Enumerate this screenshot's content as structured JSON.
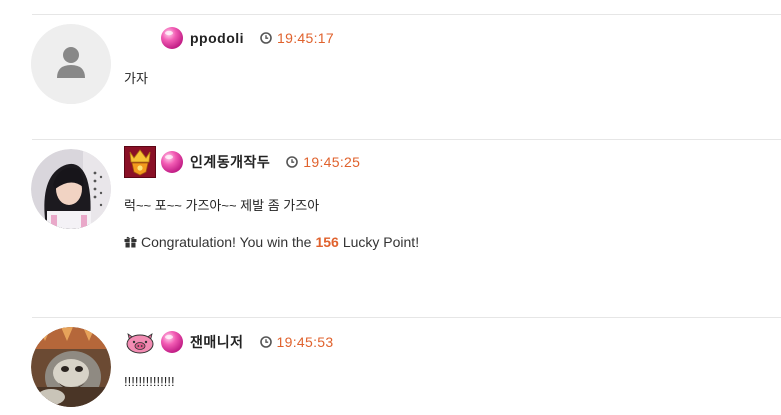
{
  "comments": [
    {
      "nickname": "ppodoli",
      "time": "19:45:17",
      "message": "가자"
    },
    {
      "nickname": "인계동개작두",
      "time": "19:45:25",
      "message": "럭~~ 포~~ 가즈아~~ 제발 좀 가즈아",
      "lucky": {
        "prefix": "Congratulation! You win the",
        "points": "156",
        "suffix": "Lucky Point!"
      }
    },
    {
      "nickname": "잰매니저",
      "time": "19:45:53",
      "message": "!!!!!!!!!!!!!!"
    }
  ],
  "colors": {
    "time": "#e0622d",
    "points": "#e0622d",
    "level_badge": "#ee3fa0"
  },
  "icons": {
    "level": "pink-orb-icon",
    "clock": "clock-icon",
    "gift": "gift-icon",
    "default_avatar": "user-silhouette-icon"
  }
}
